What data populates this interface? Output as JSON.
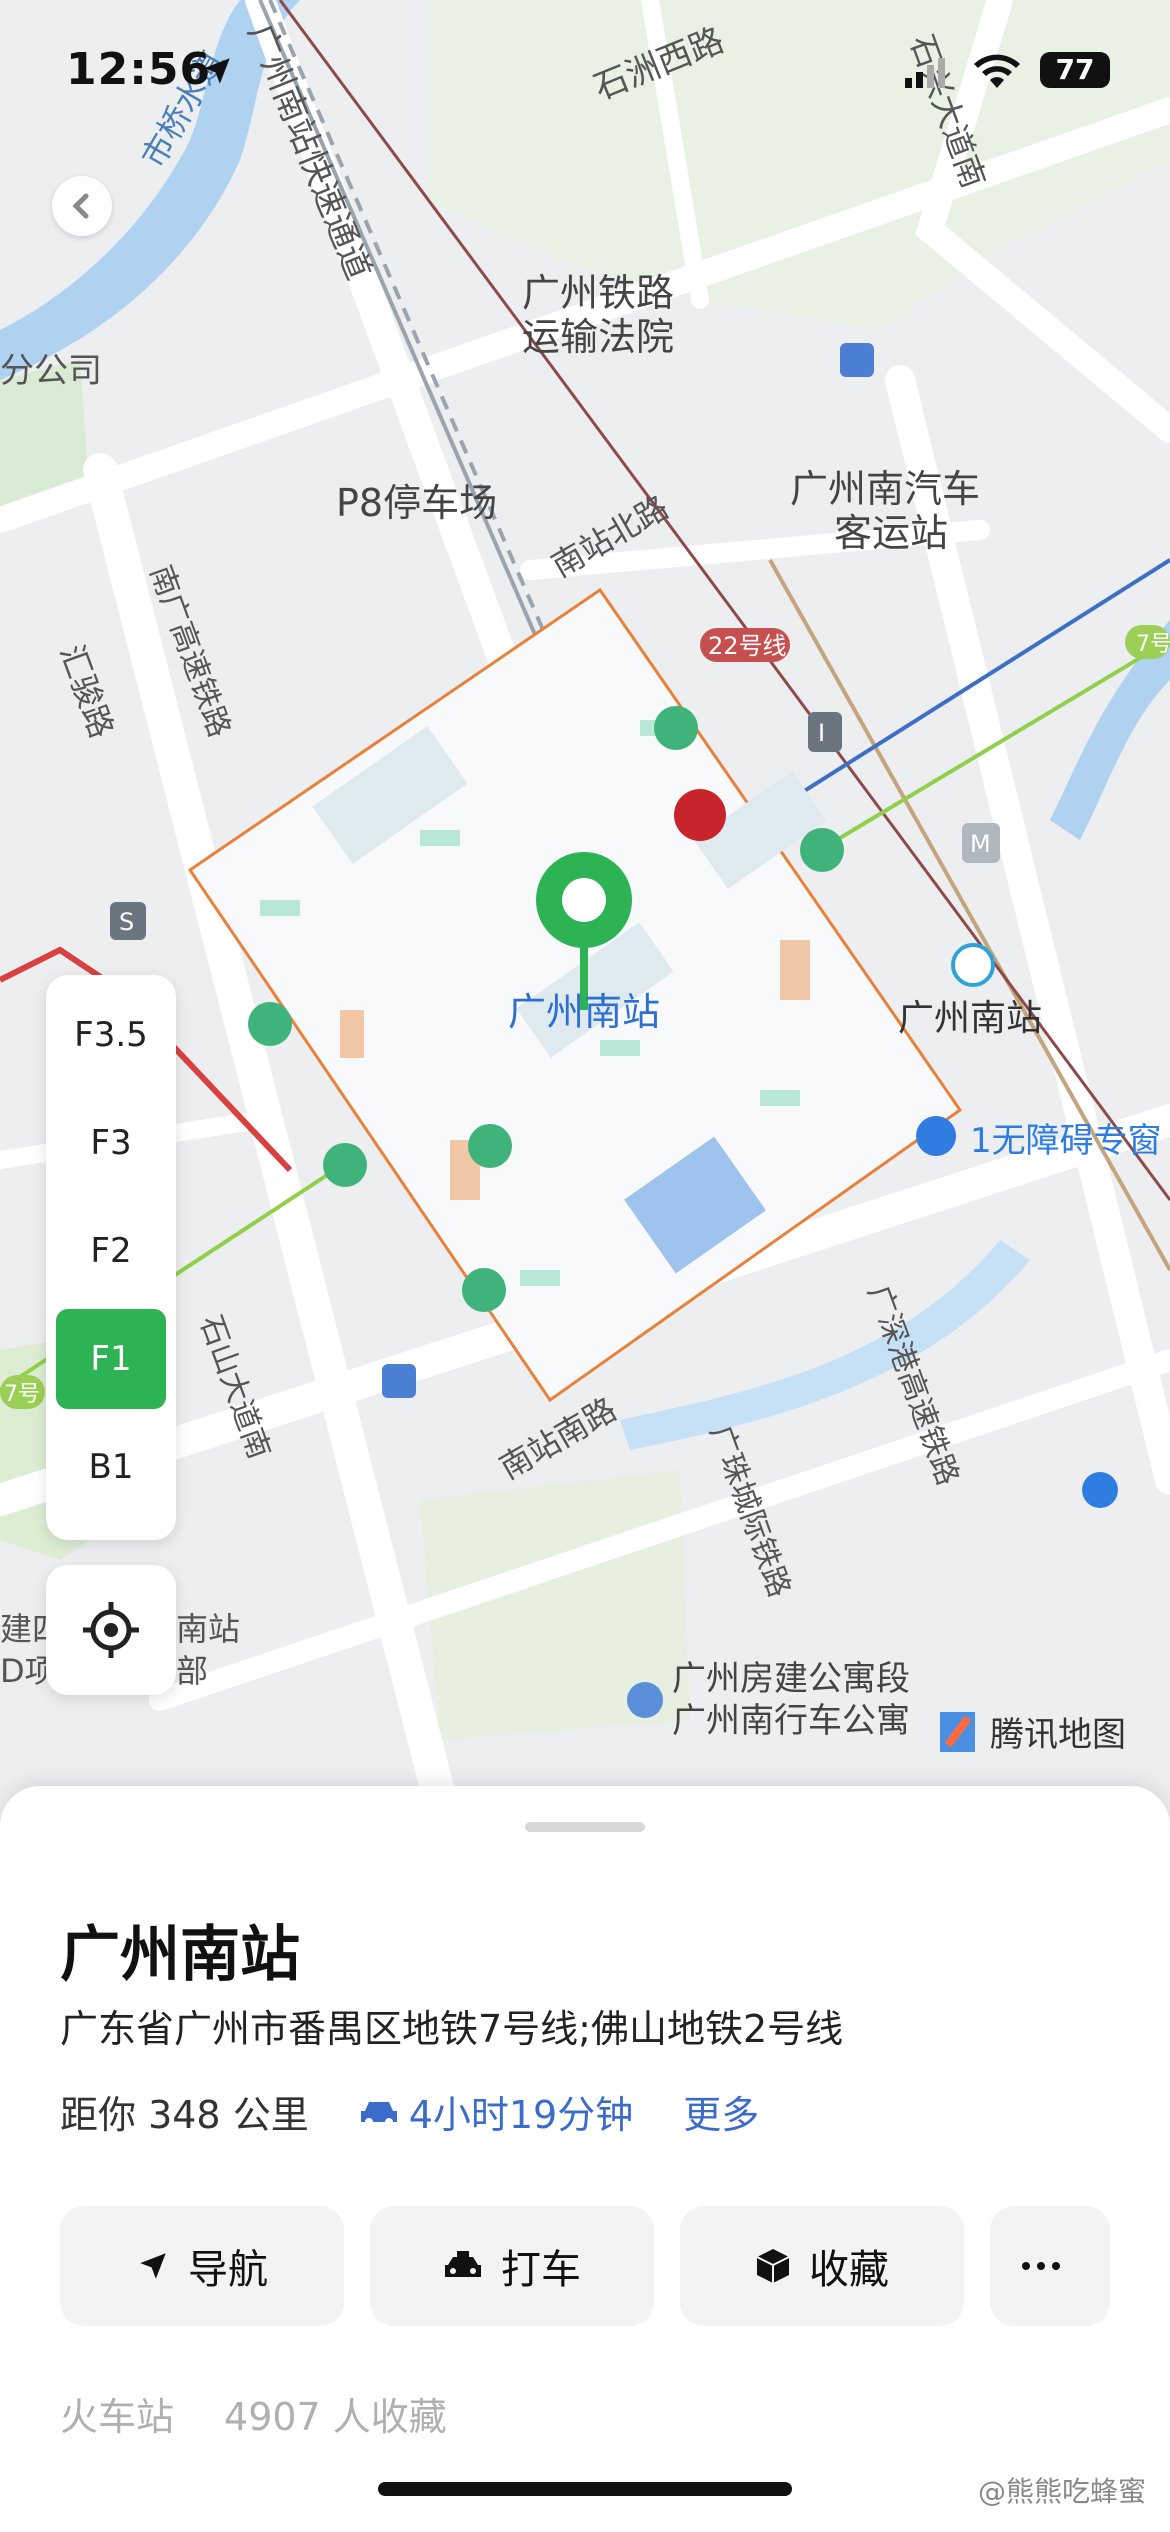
{
  "status_bar": {
    "time": "12:56",
    "battery": "77"
  },
  "map": {
    "station_label": "广州南站",
    "labels": {
      "shizhou_road": "石洲西路",
      "shixi_road": "石兴大道南",
      "expressway": "广州南站快速通道",
      "river": "市桥水道",
      "branch": "分公司",
      "court_1": "广州铁路",
      "court_2": "运输法院",
      "parking": "P8停车场",
      "bus_1": "广州南汽车",
      "bus_2": "客运站",
      "nanzhan_north": "南站北路",
      "line22": "22号线",
      "nanguang": "南广高速铁路",
      "huijun": "汇骏路",
      "station_right": "广州南站",
      "accessible": "1无障碍专窗",
      "shishan": "石山大道南",
      "nanzhan_south": "南站南路",
      "guangshengang": "广深港高速铁路",
      "guangzhu": "广珠城际铁路",
      "apartment_1": "广州房建公寓段",
      "apartment_2": "广州南行车公寓",
      "tencent": "腾讯地图",
      "line7": "7号",
      "s_icon": "S",
      "m_icon": "M",
      "i_icon": "I",
      "left_1": "建四",
      "left_2": "D项",
      "left_3": "南站",
      "left_4": "部"
    },
    "floors": [
      "F3.5",
      "F3",
      "F2",
      "F1",
      "B1"
    ],
    "active_floor": "F1"
  },
  "place": {
    "title": "广州南站",
    "address": "广东省广州市番禺区地铁7号线;佛山地铁2号线",
    "distance": "距你 348 公里",
    "drive_time": "4小时19分钟",
    "more": "更多",
    "category": "火车站",
    "favorites": "4907 人收藏"
  },
  "actions": {
    "navigate": "导航",
    "taxi": "打车",
    "favorite": "收藏",
    "more_icon": "more-dots"
  },
  "watermark": "@熊熊吃蜂蜜",
  "colors": {
    "green": "#2eb354",
    "blue": "#3b6cc9",
    "orange": "#e8813a"
  }
}
